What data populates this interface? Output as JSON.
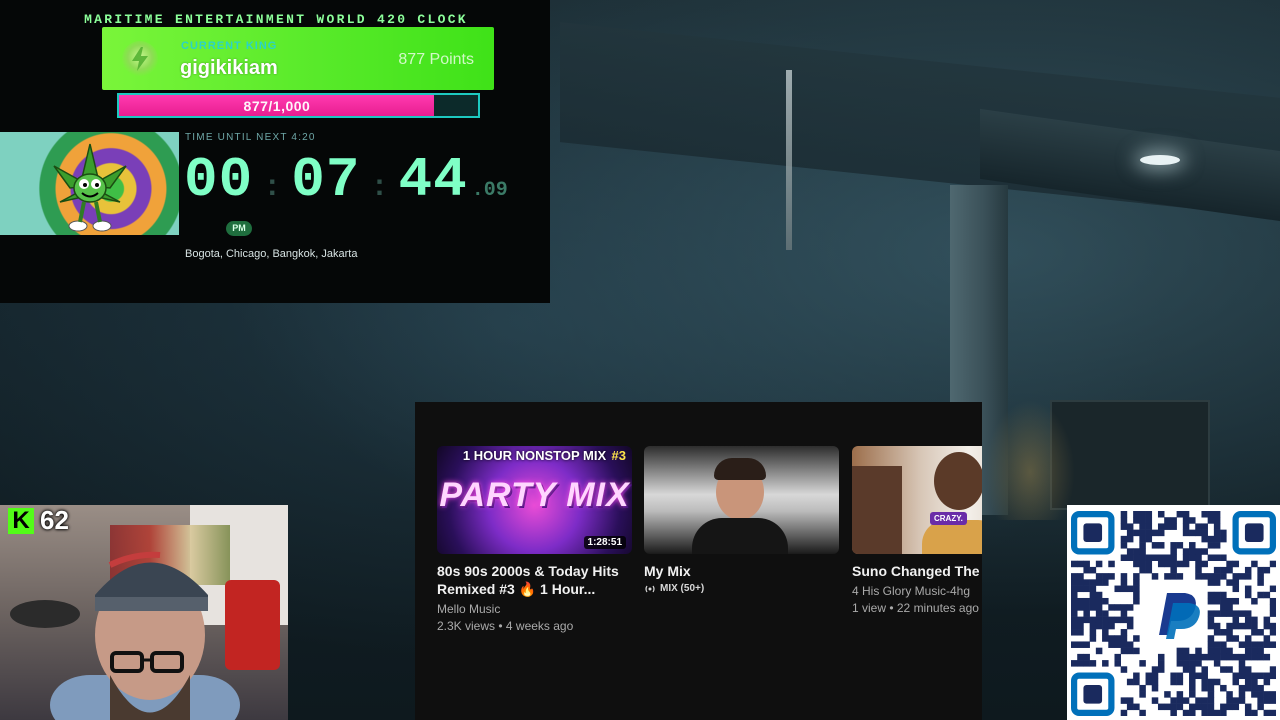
{
  "clock_panel": {
    "title": "MARITIME ENTERTAINMENT WORLD 420 CLOCK",
    "king_label": "CURRENT KING",
    "king_name": "gigikikiam",
    "king_points": "877 Points",
    "progress_text": "877/1,000",
    "progress_value": 0.877,
    "countdown_label": "TIME UNTIL NEXT 4:20",
    "hours": "00",
    "minutes": "07",
    "seconds": "44",
    "fraction": ".09",
    "meridiem": "PM",
    "cities": "Bogota, Chicago, Bangkok, Jakarta"
  },
  "viewer_badge": {
    "logo": "K",
    "count": "62"
  },
  "youtube": {
    "videos": [
      {
        "banner": "1 HOUR NONSTOP MIX",
        "banner_num": "#3",
        "thumb_text": "PARTY MIX",
        "duration": "1:28:51",
        "title": "80s 90s 2000s & Today Hits Remixed #3 🔥 1 Hour...",
        "channel": "Mello Music",
        "stats": "2.3K views • 4 weeks ago"
      },
      {
        "title": "My Mix",
        "mix_badge": "MIX (50+)"
      },
      {
        "tag": "CRAZY.",
        "title": "Suno Changed The C",
        "channel": "4 His Glory Music-4hg",
        "stats": "1 view • 22 minutes ago"
      }
    ]
  },
  "qr": {
    "icon": "paypal-icon",
    "accent": "#0070ba"
  }
}
